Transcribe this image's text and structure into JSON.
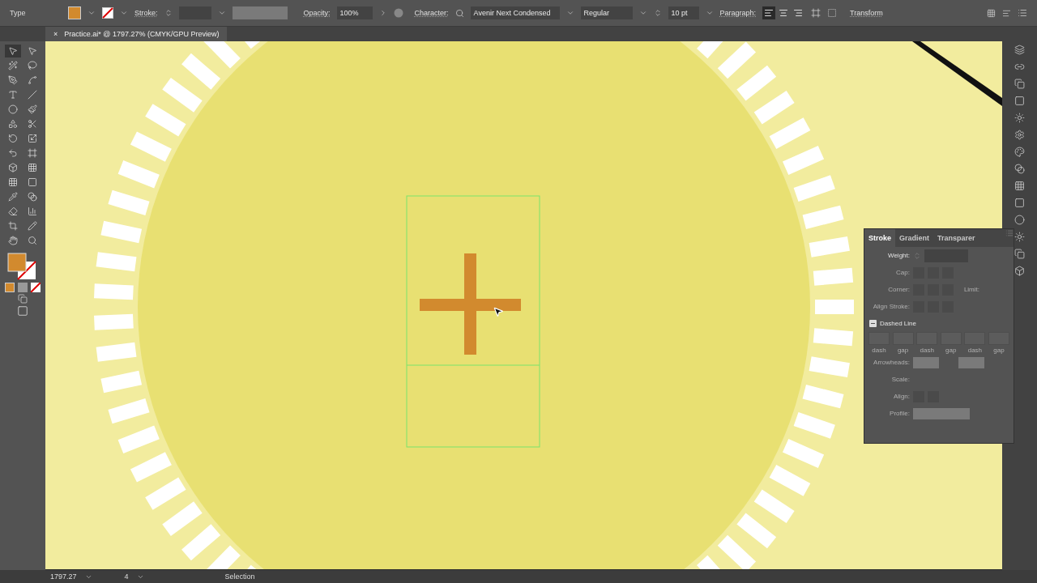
{
  "control_bar": {
    "mode": "Type",
    "stroke_label": "Stroke:",
    "opacity_label": "Opacity:",
    "opacity": "100%",
    "character_label": "Character:",
    "font": "Avenir Next Condensed",
    "style": "Regular",
    "size": "10 pt",
    "paragraph_label": "Paragraph:",
    "align": [
      {
        "selected": true
      },
      {
        "selected": false
      },
      {
        "selected": false
      }
    ],
    "transform": "Transform"
  },
  "document_tab": {
    "close": "×",
    "title": "Practice.ai* @ 1797.27% (CMYK/GPU Preview)"
  },
  "tools": [
    {
      "selected": true
    },
    {
      "selected": false
    },
    {
      "selected": false
    },
    {
      "selected": false
    },
    {
      "selected": false
    },
    {
      "selected": false
    },
    {
      "selected": false
    },
    {
      "selected": false
    },
    {
      "selected": false
    },
    {
      "selected": false
    },
    {
      "selected": false
    },
    {
      "selected": false
    },
    {
      "selected": false
    },
    {
      "selected": false
    },
    {
      "selected": false
    },
    {
      "selected": false
    },
    {
      "selected": false
    },
    {
      "selected": false
    },
    {
      "selected": false
    },
    {
      "selected": false
    },
    {
      "selected": false
    },
    {
      "selected": false
    },
    {
      "selected": false
    },
    {
      "selected": false
    },
    {
      "selected": false
    },
    {
      "selected": false
    },
    {
      "selected": false
    },
    {
      "selected": false
    }
  ],
  "stroke_panel": {
    "tabs": [
      {
        "label": "Stroke",
        "selected": true
      },
      {
        "label": "Gradient",
        "selected": false
      },
      {
        "label": "Transparer",
        "selected": false
      }
    ],
    "weight_label": "Weight:",
    "cap_label": "Cap:",
    "corner_label": "Corner:",
    "limit_label": "Limit:",
    "align_stroke_label": "Align Stroke:",
    "dashed_line_label": "Dashed Line",
    "dash_labels": [
      "dash",
      "gap",
      "dash",
      "gap",
      "dash",
      "gap"
    ],
    "arrowheads_label": "Arrowheads:",
    "scale_label": "Scale:",
    "align_label": "Align:",
    "profile_label": "Profile:"
  },
  "status_bar": {
    "zoom": "1797.27",
    "artboard": "4",
    "tool": "Selection"
  }
}
